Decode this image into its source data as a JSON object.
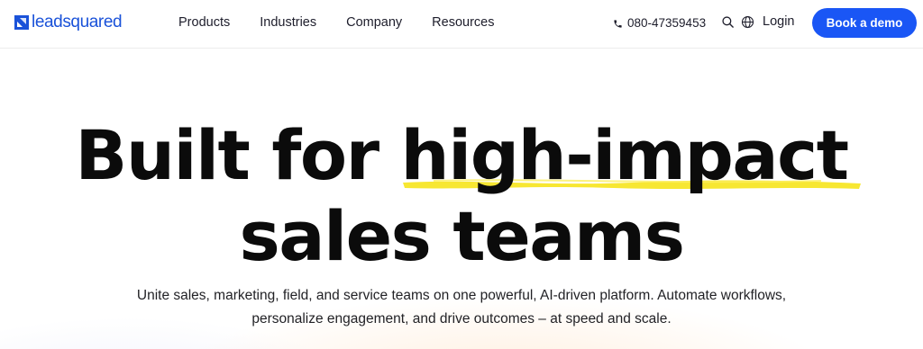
{
  "header": {
    "logo_text": "leadsquared",
    "brand_color": "#1a52d9",
    "nav": [
      "Products",
      "Industries",
      "Company",
      "Resources"
    ],
    "phone": "080-47359453",
    "login_label": "Login",
    "cta_label": "Book a demo",
    "cta_color": "#1a56f5",
    "icons": [
      "phone-icon",
      "search-icon",
      "globe-icon"
    ]
  },
  "hero": {
    "title_part1": "Built for ",
    "title_highlight": "high-impact",
    "title_line2": "sales teams",
    "highlight_color": "#f6e521",
    "subtitle_line1": "Unite sales, marketing, field, and service teams on one powerful, AI-driven platform. Automate workflows,",
    "subtitle_line2": "personalize engagement, and drive outcomes – at speed and scale."
  }
}
